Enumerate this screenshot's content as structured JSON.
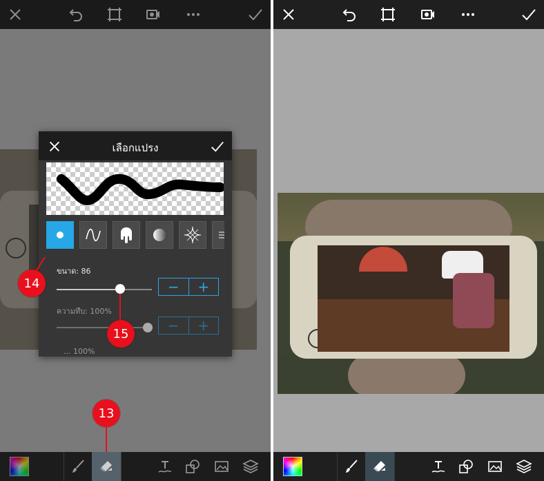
{
  "left": {
    "topbar": {
      "icons": [
        "close-icon",
        "undo-icon",
        "crop-icon",
        "video-record-icon",
        "more-icon",
        "check-icon"
      ]
    },
    "dialog": {
      "title": "เลือกแปรง",
      "brushes": [
        "dot-brush",
        "wave-brush",
        "drip-brush",
        "gradient-circle-brush",
        "sparkle-brush",
        "more-brush"
      ],
      "size_label": "ขนาด: 86",
      "size_value": 86,
      "opacity_label": "ความทึบ: 100%",
      "opacity_value": 100,
      "stepper_minus": "−",
      "stepper_plus": "+",
      "next_label_partial": "... 100%"
    },
    "annotations": [
      "14",
      "15",
      "13"
    ],
    "bottombar": {
      "items": [
        "color-swatch",
        "brush-icon",
        "eraser-icon",
        "text-icon",
        "shape-icon",
        "image-icon",
        "layers-icon"
      ]
    }
  },
  "right": {
    "topbar": {
      "icons": [
        "close-icon",
        "undo-icon",
        "crop-icon",
        "video-record-icon",
        "more-icon",
        "check-icon"
      ]
    },
    "bottombar": {
      "items": [
        "color-swatch",
        "brush-icon",
        "eraser-icon",
        "text-icon",
        "shape-icon",
        "image-icon",
        "layers-icon"
      ]
    }
  },
  "colors": {
    "accent": "#27a7e7",
    "annotation": "#e8101c",
    "toolbar": "#1f1f1f"
  }
}
